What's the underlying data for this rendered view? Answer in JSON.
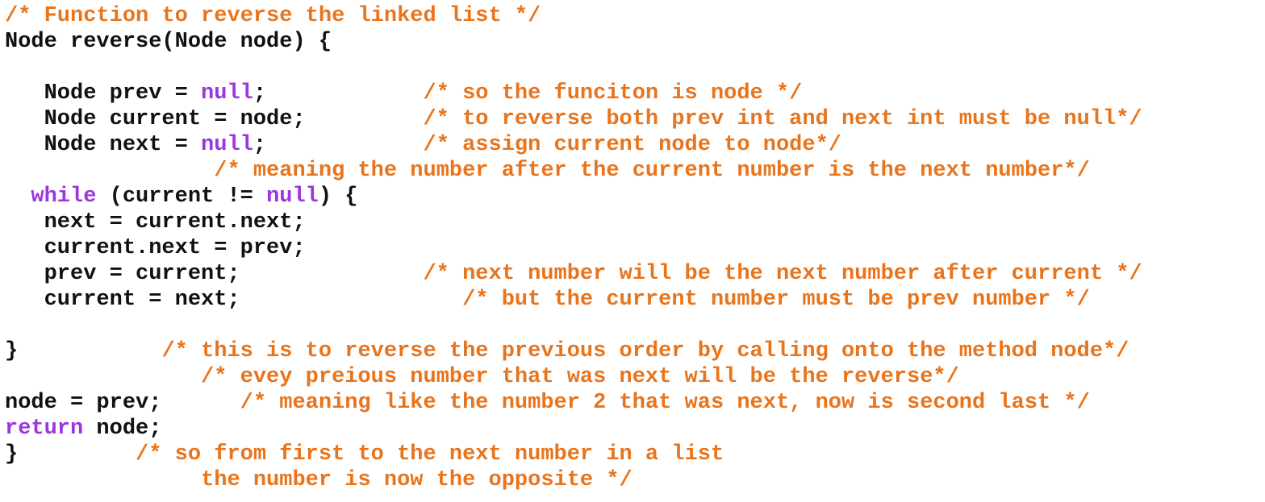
{
  "colors": {
    "comment": "#e8741c",
    "keyword": "#9b37dc",
    "code": "#111111",
    "background": "#ffffff"
  },
  "lines": [
    [
      {
        "t": "comment",
        "v": "/* Function to reverse the linked list */"
      }
    ],
    [
      {
        "t": "code",
        "v": "Node reverse(Node node) {"
      }
    ],
    [],
    [
      {
        "t": "code",
        "v": "   Node prev = "
      },
      {
        "t": "keyword",
        "v": "null"
      },
      {
        "t": "code",
        "v": ";            "
      },
      {
        "t": "comment",
        "v": "/* so the funciton is node */"
      }
    ],
    [
      {
        "t": "code",
        "v": "   Node current = node;         "
      },
      {
        "t": "comment",
        "v": "/* to reverse both prev int and next int must be null*/"
      }
    ],
    [
      {
        "t": "code",
        "v": "   Node next = "
      },
      {
        "t": "keyword",
        "v": "null"
      },
      {
        "t": "code",
        "v": ";            "
      },
      {
        "t": "comment",
        "v": "/* assign current node to node*/"
      }
    ],
    [
      {
        "t": "code",
        "v": "                "
      },
      {
        "t": "comment",
        "v": "/* meaning the number after the current number is the next number*/"
      }
    ],
    [
      {
        "t": "code",
        "v": "  "
      },
      {
        "t": "keyword",
        "v": "while"
      },
      {
        "t": "code",
        "v": " (current != "
      },
      {
        "t": "keyword",
        "v": "null"
      },
      {
        "t": "code",
        "v": ") {"
      }
    ],
    [
      {
        "t": "code",
        "v": "   next = current.next;"
      }
    ],
    [
      {
        "t": "code",
        "v": "   current.next = prev;"
      }
    ],
    [
      {
        "t": "code",
        "v": "   prev = current;              "
      },
      {
        "t": "comment",
        "v": "/* next number will be the next number after current */"
      }
    ],
    [
      {
        "t": "code",
        "v": "   current = next;                 "
      },
      {
        "t": "comment",
        "v": "/* but the current number must be prev number */"
      }
    ],
    [],
    [
      {
        "t": "code",
        "v": "}           "
      },
      {
        "t": "comment",
        "v": "/* this is to reverse the previous order by calling onto the method node*/"
      }
    ],
    [
      {
        "t": "code",
        "v": "               "
      },
      {
        "t": "comment",
        "v": "/* evey preious number that was next will be the reverse*/"
      }
    ],
    [
      {
        "t": "code",
        "v": "node = prev;      "
      },
      {
        "t": "comment",
        "v": "/* meaning like the number 2 that was next, now is second last */"
      }
    ],
    [
      {
        "t": "keyword",
        "v": "return"
      },
      {
        "t": "code",
        "v": " node;"
      }
    ],
    [
      {
        "t": "code",
        "v": "}         "
      },
      {
        "t": "comment",
        "v": "/* so from first to the next number in a list"
      }
    ],
    [
      {
        "t": "code",
        "v": "               "
      },
      {
        "t": "comment",
        "v": "the number is now the opposite */"
      }
    ]
  ]
}
